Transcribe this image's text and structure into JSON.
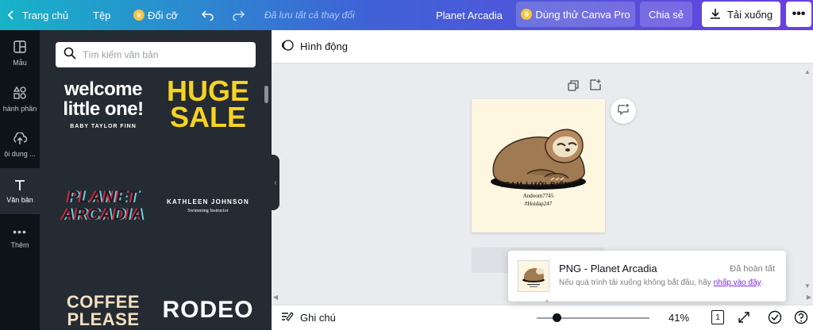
{
  "topbar": {
    "home_label": "Trang chủ",
    "file_label": "Tệp",
    "resize_label": "Đổi cỡ",
    "save_status": "Đã lưu tất cả thay đổi",
    "design_title": "Planet Arcadia",
    "try_pro_label": "Dùng thử Canva Pro",
    "share_label": "Chia sẻ",
    "download_label": "Tải xuống"
  },
  "rail": {
    "items": [
      {
        "label": "Mẫu",
        "icon": "template-icon"
      },
      {
        "label": "hành phần",
        "icon": "elements-icon"
      },
      {
        "label": "ội dung ...",
        "icon": "upload-cloud-icon"
      },
      {
        "label": "Văn bản",
        "icon": "text-icon"
      },
      {
        "label": "Thêm",
        "icon": "more-dots-icon"
      }
    ]
  },
  "panel": {
    "search_placeholder": "Tìm kiếm văn bản",
    "templates": {
      "welcome_line1": "welcome",
      "welcome_line2": "little one!",
      "welcome_sub": "BABY TAYLOR FINN",
      "huge_line1": "HUGE",
      "huge_line2": "SALE",
      "planet_line1": "PLANET",
      "planet_line2": "ARCADIA",
      "kathleen_name": "KATHLEEN JOHNSON",
      "kathleen_sub": "Swimming Instructor",
      "coffee_line1": "COFFEE",
      "coffee_line2": "PLEASE",
      "rodeo": "RODEO"
    }
  },
  "subbar": {
    "animate_label": "Hình động"
  },
  "design": {
    "team_text": "TEAM LƯỜI BIẾNG",
    "line1": "Andoom7745",
    "line2": "#Hoidap247"
  },
  "bottombar": {
    "notes_label": "Ghi chú",
    "zoom_percent": "41%",
    "zoom_fraction": 0.18,
    "page_count": "1"
  },
  "toast": {
    "format": "PNG",
    "separator": " - ",
    "name": "Planet Arcadia",
    "status": "Đã hoàn tất",
    "msg_prefix": "Nếu quá trình tải xuống không bắt đầu, hãy ",
    "msg_link": "nhấp vào đây",
    "msg_suffix": "."
  },
  "colors": {
    "gradient_start": "#17b3c8",
    "gradient_end": "#6a3fe0",
    "panel_bg": "#252b33",
    "rail_bg": "#0e1318",
    "link_purple": "#7d2ae8",
    "huge_yellow": "#f6d322"
  }
}
